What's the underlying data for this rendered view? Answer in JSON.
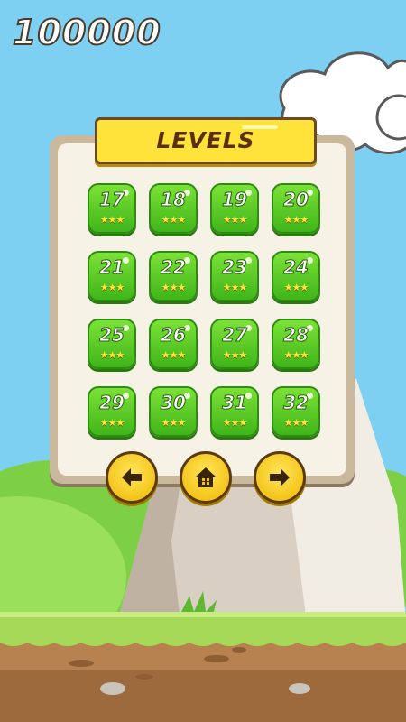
{
  "hud": {
    "score": "100000"
  },
  "panel": {
    "title": "LEVELS"
  },
  "levels": [
    {
      "number": "17",
      "stars": 3
    },
    {
      "number": "18",
      "stars": 3
    },
    {
      "number": "19",
      "stars": 3
    },
    {
      "number": "20",
      "stars": 3
    },
    {
      "number": "21",
      "stars": 3
    },
    {
      "number": "22",
      "stars": 3
    },
    {
      "number": "23",
      "stars": 3
    },
    {
      "number": "24",
      "stars": 3
    },
    {
      "number": "25",
      "stars": 3
    },
    {
      "number": "26",
      "stars": 3
    },
    {
      "number": "27",
      "stars": 3
    },
    {
      "number": "28",
      "stars": 3
    },
    {
      "number": "29",
      "stars": 3
    },
    {
      "number": "30",
      "stars": 3
    },
    {
      "number": "31",
      "stars": 3
    },
    {
      "number": "32",
      "stars": 3
    }
  ],
  "nav": {
    "prev_icon": "arrow-left-icon",
    "home_icon": "home-icon",
    "next_icon": "arrow-right-icon"
  },
  "colors": {
    "sky": "#7ed0f2",
    "banner": "#ffe23a",
    "level_tile": "#4cc224",
    "nav_button": "#f7c600"
  }
}
